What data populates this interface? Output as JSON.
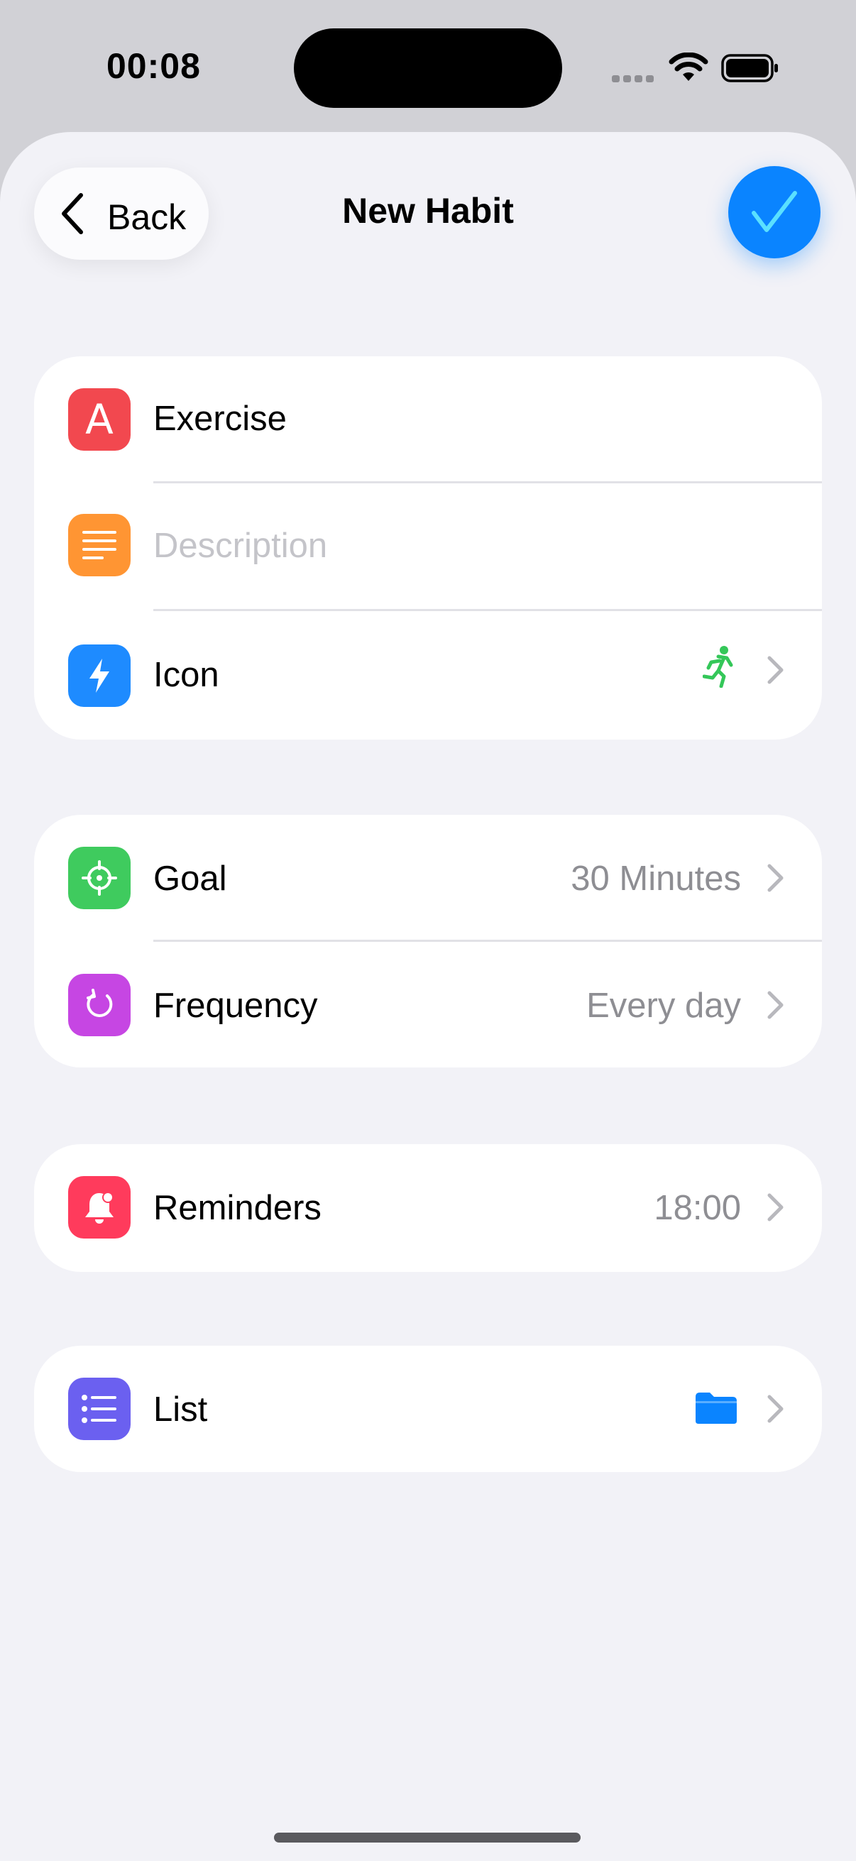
{
  "status_bar": {
    "time": "00:08"
  },
  "header": {
    "back_label": "Back",
    "title": "New Habit"
  },
  "colors": {
    "accent": "#0a84ff",
    "name_icon": "#f2484f",
    "description_icon": "#ff9533",
    "icon_icon": "#1e8bff",
    "goal_icon": "#3fcb5e",
    "frequency_icon": "#c646e3",
    "reminders_icon": "#ff3b5c",
    "list_icon": "#6b60f0",
    "selected_icon": "#34c759",
    "folder": "#0a84ff"
  },
  "section_basic": {
    "name_value": "Exercise",
    "description_placeholder": "Description",
    "icon_label": "Icon",
    "icon_selected": "running-figure-icon"
  },
  "section_schedule": {
    "goal_label": "Goal",
    "goal_value": "30 Minutes",
    "frequency_label": "Frequency",
    "frequency_value": "Every day"
  },
  "section_reminders": {
    "reminders_label": "Reminders",
    "reminders_value": "18:00"
  },
  "section_list": {
    "list_label": "List",
    "list_icon": "folder-icon"
  }
}
